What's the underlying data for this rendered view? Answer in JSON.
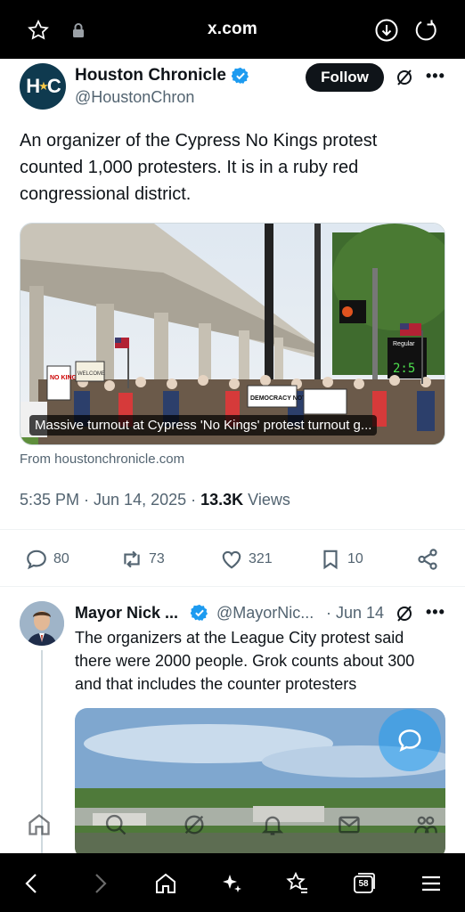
{
  "browser": {
    "url": "x.com",
    "tab_count": "58"
  },
  "tweet": {
    "author_name": "Houston Chronicle",
    "author_handle": "@HoustonChron",
    "avatar_text": "HC",
    "follow_label": "Follow",
    "text": "An organizer of the Cypress No Kings protest counted 1,000 protesters. It is in a ruby red congressional district.",
    "media_caption": "Massive turnout at Cypress 'No Kings' protest turnout g...",
    "source": "From houstonchronicle.com",
    "timestamp": "5:35 PM · Jun 14, 2025 · ",
    "views_count": "13.3K",
    "views_label": " Views",
    "sign_texts": [
      "WELCOME",
      "NO KINGS",
      "DEMOCRACY NOT",
      "Regular",
      "2:5"
    ],
    "stats": {
      "replies": "80",
      "reposts": "73",
      "likes": "321",
      "bookmarks": "10"
    }
  },
  "reply": {
    "author_name": "Mayor Nick ...",
    "author_handle": "@MayorNic...",
    "date": "· Jun 14",
    "text": "The organizers at the League City protest said there were 2000 people. Grok counts about 300 and that includes the counter protesters"
  },
  "colors": {
    "verified_blue": "#1d9bf0",
    "text_primary": "#0f1419",
    "text_secondary": "#536471",
    "browser_bar": "#000000"
  },
  "icons": [
    "star-icon",
    "lock-icon",
    "download-icon",
    "reload-icon",
    "verified-icon",
    "grok-icon",
    "more-icon",
    "reply-icon",
    "repost-icon",
    "like-icon",
    "bookmark-icon",
    "share-icon",
    "home-icon",
    "search-icon",
    "bell-icon",
    "mail-icon",
    "communities-icon",
    "back-icon",
    "forward-icon",
    "sparkle-icon",
    "favorites-icon",
    "tabs-icon",
    "menu-icon"
  ]
}
